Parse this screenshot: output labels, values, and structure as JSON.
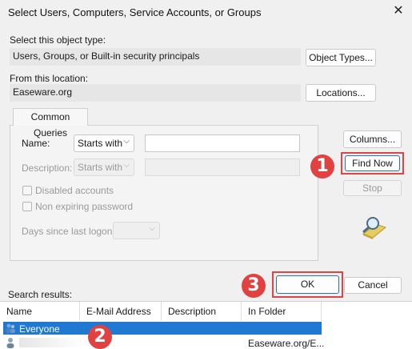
{
  "window": {
    "title": "Select Users, Computers, Service Accounts, or Groups",
    "close_glyph": "✕"
  },
  "object_type": {
    "label": "Select this object type:",
    "value": "Users, Groups, or Built-in security principals",
    "button": "Object Types..."
  },
  "location": {
    "label": "From this location:",
    "value": "Easeware.org",
    "button": "Locations..."
  },
  "common_queries": {
    "tab": "Common Queries",
    "name_label": "Name:",
    "name_filter": "Starts with",
    "name_value": "",
    "description_label": "Description:",
    "description_filter": "Starts with",
    "disabled_accounts": "Disabled accounts",
    "non_expiring": "Non expiring password",
    "days_label": "Days since last logon:",
    "chevron": "⌵"
  },
  "buttons": {
    "columns": "Columns...",
    "find_now": "Find Now",
    "stop": "Stop",
    "ok": "OK",
    "cancel": "Cancel"
  },
  "annotations": {
    "one": "1",
    "two": "2",
    "three": "3"
  },
  "results": {
    "label": "Search results:",
    "columns": [
      "Name",
      "E-Mail Address",
      "Description",
      "In Folder"
    ],
    "rows": [
      {
        "name": "Everyone",
        "email": "",
        "description": "",
        "folder": "",
        "selected": true
      },
      {
        "name": "",
        "email": "",
        "description": "",
        "folder": "Easeware.org/E...",
        "selected": false
      }
    ]
  },
  "colors": {
    "accent": "#1f78d1",
    "annotation_red": "#e14141"
  }
}
